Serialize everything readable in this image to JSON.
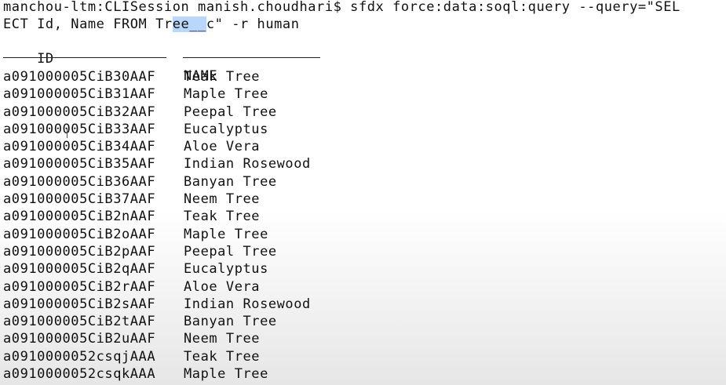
{
  "terminal": {
    "prompt_line_1_a": "manchou-ltm:CLISession manish.choudhari$ sfdx force:data:soql:query --query=\"SEL",
    "prompt_line_2_before": "ECT Id, Name FROM Tr",
    "prompt_line_2_selected": "ee__",
    "prompt_line_2_after": "c\" -r human",
    "header_id": "ID",
    "header_name": "NAME",
    "rows": [
      {
        "id": "a091000005CiB30AAF",
        "name": "Teak Tree"
      },
      {
        "id": "a091000005CiB31AAF",
        "name": "Maple Tree"
      },
      {
        "id": "a091000005CiB32AAF",
        "name": "Peepal Tree"
      },
      {
        "id": "a091000005CiB33AAF",
        "name": "Eucalyptus"
      },
      {
        "id": "a091000005CiB34AAF",
        "name": "Aloe Vera"
      },
      {
        "id": "a091000005CiB35AAF",
        "name": "Indian Rosewood"
      },
      {
        "id": "a091000005CiB36AAF",
        "name": "Banyan Tree"
      },
      {
        "id": "a091000005CiB37AAF",
        "name": "Neem Tree"
      },
      {
        "id": "a091000005CiB2nAAF",
        "name": "Teak Tree"
      },
      {
        "id": "a091000005CiB2oAAF",
        "name": "Maple Tree"
      },
      {
        "id": "a091000005CiB2pAAF",
        "name": "Peepal Tree"
      },
      {
        "id": "a091000005CiB2qAAF",
        "name": "Eucalyptus"
      },
      {
        "id": "a091000005CiB2rAAF",
        "name": "Aloe Vera"
      },
      {
        "id": "a091000005CiB2sAAF",
        "name": "Indian Rosewood"
      },
      {
        "id": "a091000005CiB2tAAF",
        "name": "Banyan Tree"
      },
      {
        "id": "a091000005CiB2uAAF",
        "name": "Neem Tree"
      },
      {
        "id": "a0910000052csqjAAA",
        "name": "Teak Tree"
      },
      {
        "id": "a0910000052csqkAAA",
        "name": "Maple Tree"
      }
    ]
  },
  "colors": {
    "text": "#111111",
    "selection": "#b9d6fb",
    "background": "#ffffff"
  }
}
